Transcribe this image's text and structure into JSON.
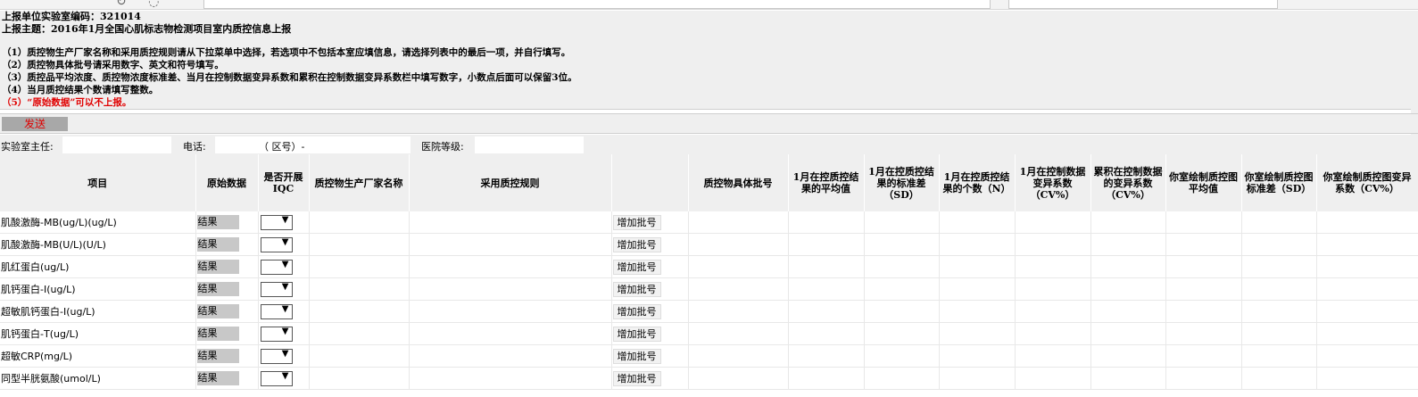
{
  "header": {
    "lab_code_line": "上报单位实验室编码：321014",
    "subject_line": "上报主题：2016年1月全国心肌标志物检测项目室内质控信息上报"
  },
  "instructions": [
    "（1）质控物生产厂家名称和采用质控规则请从下拉菜单中选择，若选项中不包括本室应填信息，请选择列表中的最后一项，并自行填写。",
    "（2）质控物具体批号请采用数字、英文和符号填写。",
    "（3）质控品平均浓度、质控物浓度标准差、当月在控制数据变异系数和累积在控制数据变异系数栏中填写数字，小数点后面可以保留3位。",
    "（4）当月质控结果个数请填写整数。"
  ],
  "warning": "（5）“原始数据”可以不上报。",
  "send_button": "发送",
  "info": {
    "director_label": "实验室主任:",
    "director_value": "",
    "phone_label": "电话:",
    "area_code_text": "（  区号）-",
    "phone_value": "",
    "hospital_level_label": "医院等级:",
    "hospital_level_value": ""
  },
  "columns": [
    "项目",
    "原始数据",
    "是否开展IQC",
    "质控物生产厂家名称",
    "采用质控规则",
    "",
    "质控物具体批号",
    "1月在控质控结果的平均值",
    "1月在控质控结果的标准差（SD）",
    "1月在控质控结果的个数（N）",
    "1月在控制数据变异系数（CV%）",
    "累积在控制数据的变异系数（CV%）",
    "你室绘制质控图平均值",
    "你室绘制质控图标准差（SD）",
    "你室绘制质控图变异系数（CV%）"
  ],
  "rows": [
    {
      "item": "肌酸激酶-MB(ug/L)(ug/L)",
      "result": "结果",
      "add": "增加批号"
    },
    {
      "item": "肌酸激酶-MB(U/L)(U/L)",
      "result": "结果",
      "add": "增加批号"
    },
    {
      "item": "肌红蛋白(ug/L)",
      "result": "结果",
      "add": "增加批号"
    },
    {
      "item": "肌钙蛋白-I(ug/L)",
      "result": "结果",
      "add": "增加批号"
    },
    {
      "item": "超敏肌钙蛋白-I(ug/L)",
      "result": "结果",
      "add": "增加批号"
    },
    {
      "item": "肌钙蛋白-T(ug/L)",
      "result": "结果",
      "add": "增加批号"
    },
    {
      "item": "超敏CRP(mg/L)",
      "result": "结果",
      "add": "增加批号"
    },
    {
      "item": "同型半胱氨酸(umol/L)",
      "result": "结果",
      "add": "增加批号"
    }
  ],
  "icons": {
    "dropdown": "chevron-down-icon"
  },
  "colors": {
    "warning_text": "#e00000",
    "header_bg": "#efefef",
    "send_button_bg": "#a8a8a8"
  }
}
